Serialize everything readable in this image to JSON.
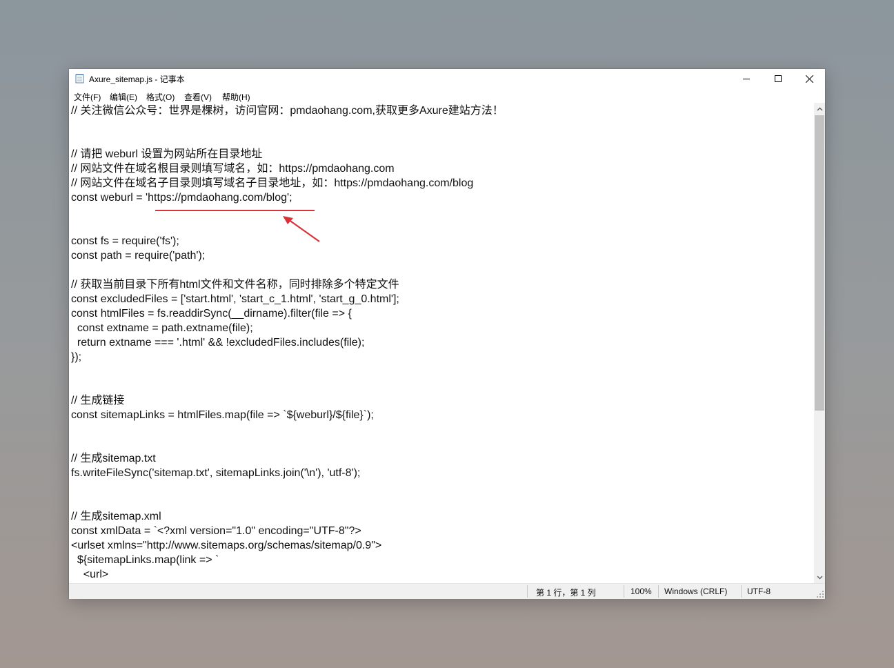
{
  "window": {
    "title": "Axure_sitemap.js - 记事本"
  },
  "menu": {
    "items": [
      "文件(F)",
      "编辑(E)",
      "格式(O)",
      "查看(V)",
      "帮助(H)"
    ]
  },
  "editor": {
    "lines": [
      "// 关注微信公众号：世界是棵树，访问官网：pmdaohang.com,获取更多Axure建站方法！",
      "",
      "",
      "// 请把 weburl 设置为网站所在目录地址",
      "// 网站文件在域名根目录则填写域名，如：https://pmdaohang.com",
      "// 网站文件在域名子目录则填写域名子目录地址，如：https://pmdaohang.com/blog",
      "const weburl = 'https://pmdaohang.com/blog';",
      "",
      "",
      "const fs = require('fs');",
      "const path = require('path');",
      "",
      "// 获取当前目录下所有html文件和文件名称，同时排除多个特定文件",
      "const excludedFiles = ['start.html', 'start_c_1.html', 'start_g_0.html'];",
      "const htmlFiles = fs.readdirSync(__dirname).filter(file => {",
      "  const extname = path.extname(file);",
      "  return extname === '.html' && !excludedFiles.includes(file);",
      "});",
      "",
      "",
      "// 生成链接",
      "const sitemapLinks = htmlFiles.map(file => `${weburl}/${file}`);",
      "",
      "",
      "// 生成sitemap.txt",
      "fs.writeFileSync('sitemap.txt', sitemapLinks.join('\\n'), 'utf-8');",
      "",
      "",
      "// 生成sitemap.xml",
      "const xmlData = `<?xml version=\"1.0\" encoding=\"UTF-8\"?>",
      "<urlset xmlns=\"http://www.sitemaps.org/schemas/sitemap/0.9\">",
      "  ${sitemapLinks.map(link => `",
      "    <url>"
    ]
  },
  "status": {
    "position": "第 1 行，第 1 列",
    "zoom": "100%",
    "line_ending": "Windows (CRLF)",
    "encoding": "UTF-8"
  },
  "annotation": {
    "color": "#d9323a"
  }
}
